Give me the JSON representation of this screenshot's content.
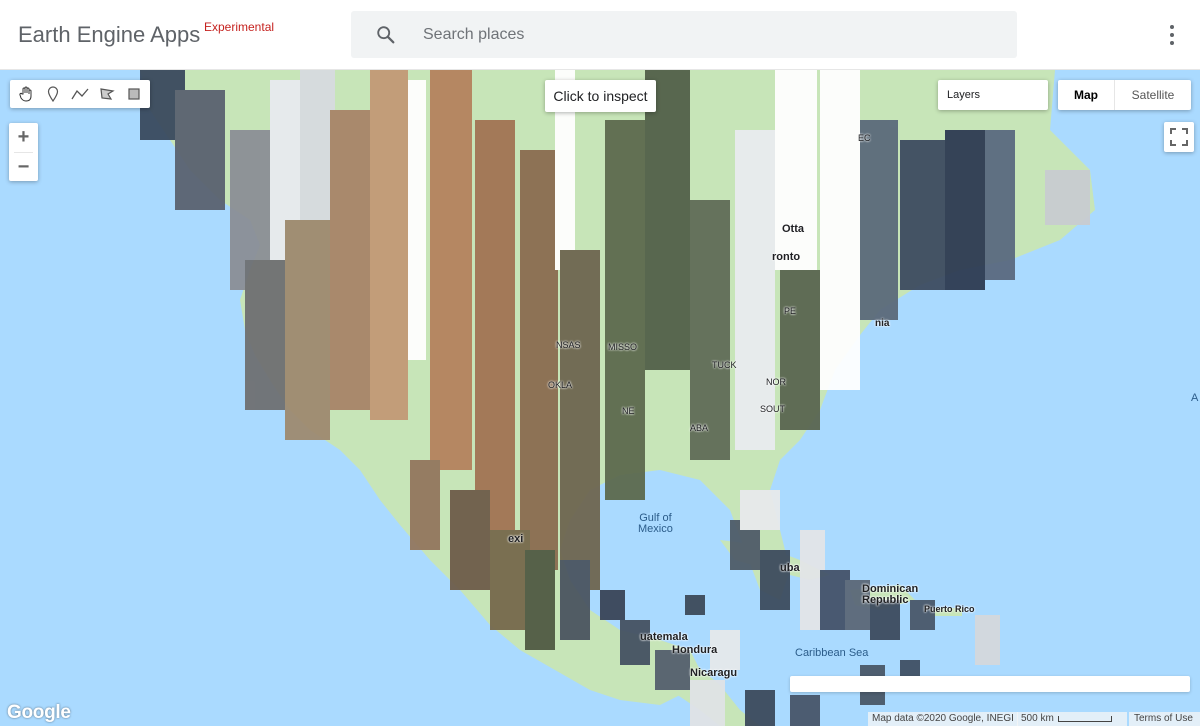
{
  "header": {
    "app_title": "Earth Engine Apps",
    "badge": "Experimental",
    "search_placeholder": "Search places",
    "more_icon": "more-vert-icon"
  },
  "map_controls": {
    "tools": [
      {
        "name": "pan-hand-icon"
      },
      {
        "name": "marker-point-icon"
      },
      {
        "name": "polyline-icon"
      },
      {
        "name": "polygon-icon"
      },
      {
        "name": "rectangle-icon"
      }
    ],
    "inspect_tip": "Click to inspect",
    "layers_label": "Layers",
    "map_type_map": "Map",
    "map_type_satellite": "Satellite",
    "zoom_in": "+",
    "zoom_out": "−"
  },
  "map_labels": {
    "gulf": "Gulf of\nMexico",
    "caribbean": "Caribbean Sea",
    "dominican": "Dominican\nRepublic",
    "puerto_rico": "Puerto Rico",
    "ottawa": "Otta",
    "toronto": "ronto",
    "cuba": "uba",
    "guatemala": "uatemala",
    "honduras": "Hondura",
    "nicaragua": "Nicaragu",
    "mexico": "exi",
    "state_ks": "NSAS",
    "state_mo": "MISSO",
    "state_ok": "OKLA",
    "state_ky": "TUCK",
    "state_nc": "NOR",
    "state_sc": "SOUT",
    "state_al": "ABA",
    "state_ec": "EC",
    "state_pe": "PE",
    "state_nia": "nia",
    "state_ne": "NE",
    "state_a": "A"
  },
  "footer": {
    "google_logo": "Google",
    "attribution": "Map data ©2020 Google, INEGI",
    "scale_label": "500 km",
    "terms": "Terms of Use"
  },
  "colors": {
    "water": "#aadaff",
    "land": "#c7e5b8",
    "accent_red": "#c5221f"
  }
}
